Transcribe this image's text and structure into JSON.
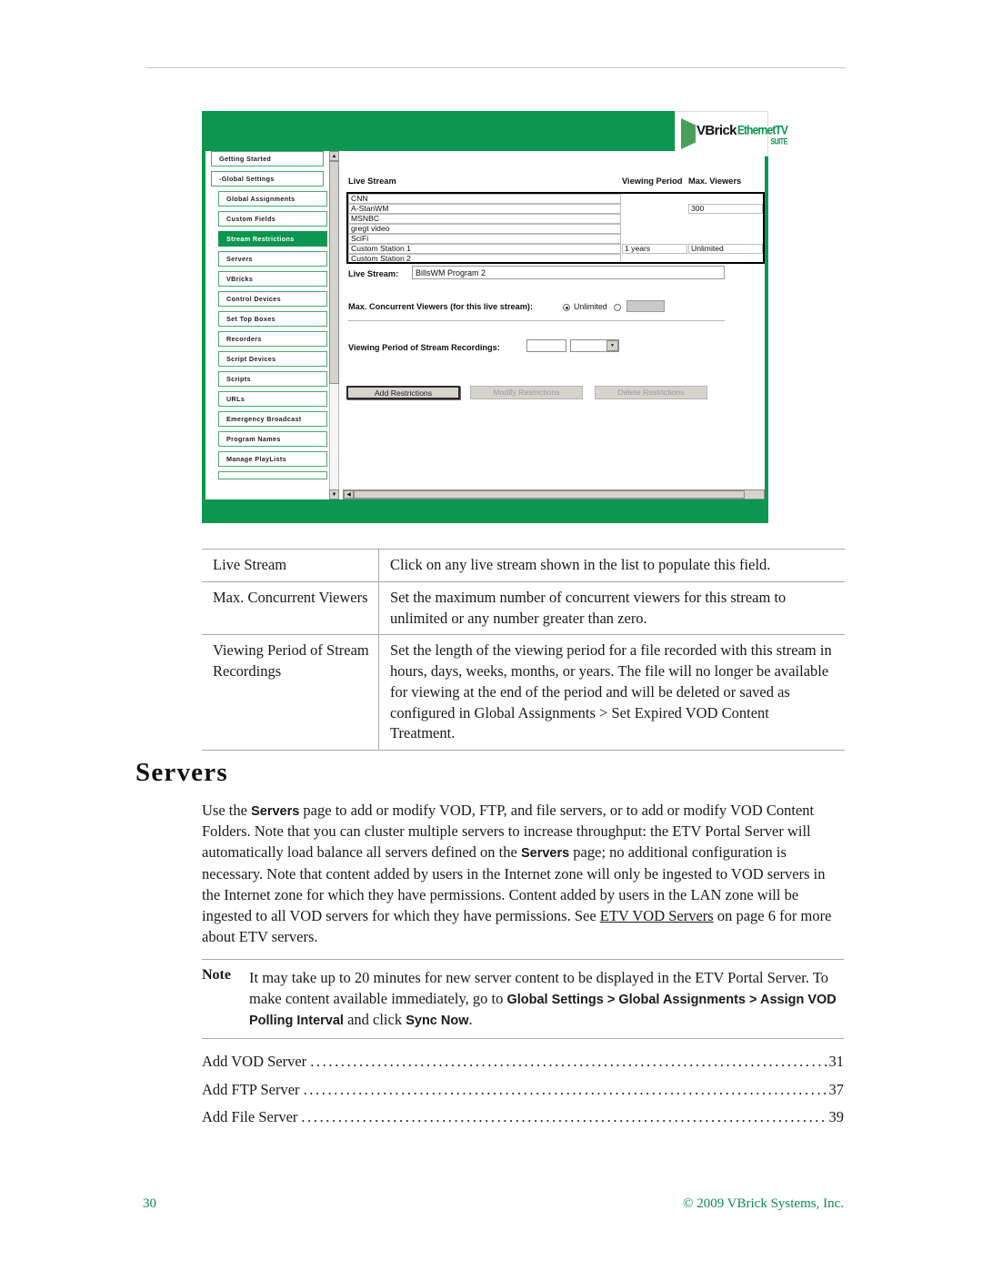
{
  "app": {
    "logo": {
      "brand": "VBrick",
      "product": "EthernetTV",
      "edition": "SUITE"
    },
    "nav": [
      {
        "label": "Getting Started",
        "level": 1,
        "active": false
      },
      {
        "label": "-Global Settings",
        "level": 1,
        "active": false
      },
      {
        "label": "Global Assignments",
        "level": 2,
        "active": false
      },
      {
        "label": "Custom Fields",
        "level": 2,
        "active": false
      },
      {
        "label": "Stream Restrictions",
        "level": 2,
        "active": true
      },
      {
        "label": "Servers",
        "level": 2,
        "active": false
      },
      {
        "label": "VBricks",
        "level": 2,
        "active": false
      },
      {
        "label": "Control Devices",
        "level": 2,
        "active": false
      },
      {
        "label": "Set Top Boxes",
        "level": 2,
        "active": false
      },
      {
        "label": "Recorders",
        "level": 2,
        "active": false
      },
      {
        "label": "Script Devices",
        "level": 2,
        "active": false
      },
      {
        "label": "Scripts",
        "level": 2,
        "active": false
      },
      {
        "label": "URLs",
        "level": 2,
        "active": false
      },
      {
        "label": "Emergency Broadcast",
        "level": 2,
        "active": false
      },
      {
        "label": "Program Names",
        "level": 2,
        "active": false
      },
      {
        "label": "Manage PlayLists",
        "level": 2,
        "active": false
      }
    ],
    "grid": {
      "headers": [
        "Live Stream",
        "Viewing Period",
        "Max. Viewers"
      ],
      "rows": [
        {
          "name": "CNN",
          "period": "",
          "viewers": ""
        },
        {
          "name": "A-StanWM",
          "period": "",
          "viewers": "300"
        },
        {
          "name": "MSNBC",
          "period": "",
          "viewers": ""
        },
        {
          "name": "gregt video",
          "period": "",
          "viewers": ""
        },
        {
          "name": "SciFi",
          "period": "",
          "viewers": ""
        },
        {
          "name": "Custom Station 1",
          "period": "1 years",
          "viewers": "Unlimited"
        },
        {
          "name": "Custom Station 2",
          "period": "",
          "viewers": ""
        }
      ]
    },
    "form": {
      "live_stream_label": "Live Stream:",
      "live_stream_value": "BillsWM Program 2",
      "max_viewers_label": "Max. Concurrent Viewers (for this live stream):",
      "unlimited_label": "Unlimited",
      "max_viewers_value": "",
      "viewing_period_label": "Viewing Period of Stream Recordings:",
      "viewing_period_value": "",
      "viewing_period_unit": ""
    },
    "buttons": {
      "add": "Add Restrictions",
      "modify": "Modify Restrictions",
      "delete": "Delete Restrictions"
    }
  },
  "deftable": [
    {
      "term": "Live Stream",
      "desc": "Click on any live stream shown in the list to populate this field."
    },
    {
      "term": "Max. Concurrent Viewers",
      "desc": "Set the maximum number of concurrent viewers for this stream to unlimited or any number greater than zero."
    },
    {
      "term": "Viewing Period of Stream Recordings",
      "desc": "Set the length of the viewing period for a file recorded with this stream in hours, days, weeks, months, or years. The file will no longer be available for viewing at the end of the period and will be deleted or saved as configured in Global Assignments > Set Expired VOD Content Treatment."
    }
  ],
  "section": {
    "heading": "Servers",
    "paragraph_html": "Use the <b>Servers</b> page to add or modify VOD, FTP, and file servers, or to add or modify VOD Content Folders. Note that you can cluster multiple servers to increase throughput: the ETV Portal Server will automatically load balance all servers defined on the <b>Servers</b> page; no additional configuration is necessary. Note that content added by users in the Internet zone will only be ingested to VOD servers in the Internet zone for which they have permissions. Content added by users in the LAN zone will be ingested to all VOD servers for which they have permissions. See <u>ETV VOD Servers</u> on page 6 for more about ETV servers."
  },
  "note": {
    "label": "Note",
    "text_html": "It may take up to 20 minutes for new server content to be displayed in the ETV Portal Server. To make content available immediately, go to <b>Global Settings &gt; Global Assignments &gt; Assign VOD Polling Interval</b> and click <b>Sync Now</b>."
  },
  "toc": [
    {
      "title": "Add VOD Server",
      "page": "31"
    },
    {
      "title": "Add FTP Server",
      "page": "37"
    },
    {
      "title": "Add File Server",
      "page": "39"
    }
  ],
  "footer": {
    "page_number": "30",
    "copyright": "© 2009 VBrick Systems, Inc."
  },
  "colors": {
    "brand_green": "#0c9650",
    "footer_green": "#0c8a50"
  }
}
